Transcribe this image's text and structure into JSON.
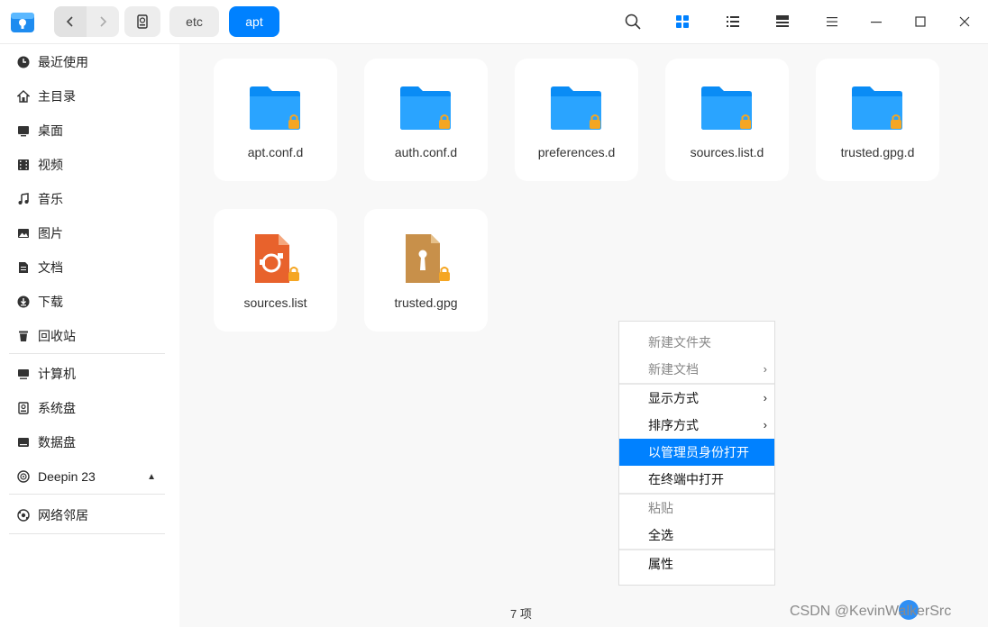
{
  "toolbar": {
    "back_icon": "chevron-left-icon",
    "forward_icon": "chevron-right-icon",
    "breadcrumbs": [
      "etc",
      "apt"
    ],
    "accent": "#0081ff"
  },
  "sidebar": {
    "items": [
      {
        "label": "最近使用",
        "icon": "clock-icon"
      },
      {
        "label": "主目录",
        "icon": "home-icon"
      },
      {
        "label": "桌面",
        "icon": "desktop-icon"
      },
      {
        "label": "视频",
        "icon": "video-icon"
      },
      {
        "label": "音乐",
        "icon": "music-icon"
      },
      {
        "label": "图片",
        "icon": "image-icon"
      },
      {
        "label": "文档",
        "icon": "document-icon"
      },
      {
        "label": "下载",
        "icon": "download-icon"
      },
      {
        "label": "回收站",
        "icon": "trash-icon"
      }
    ],
    "devices": [
      {
        "label": "计算机",
        "icon": "computer-icon"
      },
      {
        "label": "系统盘",
        "icon": "system-disk-icon"
      },
      {
        "label": "数据盘",
        "icon": "data-disk-icon"
      },
      {
        "label": "Deepin 23",
        "icon": "disc-icon"
      }
    ],
    "network": {
      "label": "网络邻居",
      "icon": "network-icon"
    }
  },
  "files": [
    {
      "name": "apt.conf.d",
      "type": "folder"
    },
    {
      "name": "auth.conf.d",
      "type": "folder"
    },
    {
      "name": "preferences.d",
      "type": "folder"
    },
    {
      "name": "sources.list.d",
      "type": "folder"
    },
    {
      "name": "trusted.gpg.d",
      "type": "folder"
    },
    {
      "name": "sources.list",
      "type": "text-file"
    },
    {
      "name": "trusted.gpg",
      "type": "key-file"
    }
  ],
  "status": {
    "count": "7 项"
  },
  "context_menu": {
    "new_folder": "新建文件夹",
    "new_document": "新建文档",
    "display_mode": "显示方式",
    "sort_by": "排序方式",
    "open_as_admin": "以管理员身份打开",
    "open_in_terminal": "在终端中打开",
    "paste": "粘贴",
    "select_all": "全选",
    "properties": "属性"
  },
  "watermark": "CSDN @KevinWalkerSrc"
}
